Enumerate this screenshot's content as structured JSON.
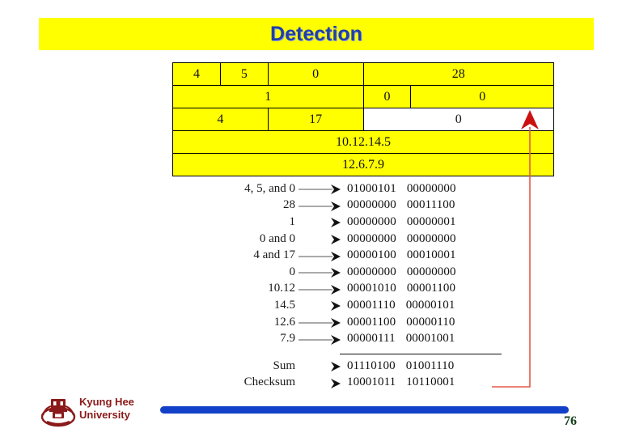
{
  "slide": {
    "title": "Detection",
    "title_bg": "#ffff00",
    "title_color": "#1f3fa8",
    "page_number": "76"
  },
  "packet_table": {
    "highlight_color": "#ffff00",
    "checksum_cell_color": "#ffffff",
    "rows": [
      {
        "cells": [
          {
            "text": "4",
            "span": 2,
            "white": false
          },
          {
            "text": "5",
            "span": 2,
            "white": false
          },
          {
            "text": "0",
            "span": 4,
            "white": false
          },
          {
            "text": "28",
            "span": 8,
            "white": false
          }
        ]
      },
      {
        "cells": [
          {
            "text": "1",
            "span": 8,
            "white": false
          },
          {
            "text": "0",
            "span": 2,
            "white": false
          },
          {
            "text": "0",
            "span": 6,
            "white": false
          }
        ]
      },
      {
        "cells": [
          {
            "text": "4",
            "span": 4,
            "white": false
          },
          {
            "text": "17",
            "span": 4,
            "white": false
          },
          {
            "text": "0",
            "span": 8,
            "white": true
          }
        ]
      },
      {
        "cells": [
          {
            "text": "10.12.14.5",
            "span": 16,
            "white": false
          }
        ]
      },
      {
        "cells": [
          {
            "text": "12.6.7.9",
            "span": 16,
            "white": false
          }
        ]
      }
    ]
  },
  "computation": {
    "arrow_color": "#555555",
    "rows": [
      {
        "label": "4, 5,  and 0",
        "long_arrow": true,
        "bits1": "01000101",
        "bits2": "00000000"
      },
      {
        "label": "28",
        "long_arrow": true,
        "bits1": "00000000",
        "bits2": "00011100"
      },
      {
        "label": "1",
        "long_arrow": false,
        "bits1": "00000000",
        "bits2": "00000001"
      },
      {
        "label": "0 and 0",
        "long_arrow": false,
        "bits1": "00000000",
        "bits2": "00000000"
      },
      {
        "label": "4 and 17",
        "long_arrow": true,
        "bits1": "00000100",
        "bits2": "00010001"
      },
      {
        "label": "0",
        "long_arrow": true,
        "bits1": "00000000",
        "bits2": "00000000"
      },
      {
        "label": "10.12",
        "long_arrow": true,
        "bits1": "00001010",
        "bits2": "00001100"
      },
      {
        "label": "14.5",
        "long_arrow": false,
        "bits1": "00001110",
        "bits2": "00000101"
      },
      {
        "label": "12.6",
        "long_arrow": true,
        "bits1": "00001100",
        "bits2": "00000110"
      },
      {
        "label": "7.9",
        "long_arrow": true,
        "bits1": "00000111",
        "bits2": "00001001"
      }
    ],
    "results": [
      {
        "label": "Sum",
        "long_arrow": false,
        "bits1": "01110100",
        "bits2": "01001110"
      },
      {
        "label": "Checksum",
        "long_arrow": false,
        "bits1": "10001011",
        "bits2": "10110001"
      }
    ]
  },
  "footer": {
    "university_line1": "Kyung Hee",
    "university_line2": "University",
    "bar_color": "#1340c8",
    "text_color": "#8b1a1a"
  }
}
